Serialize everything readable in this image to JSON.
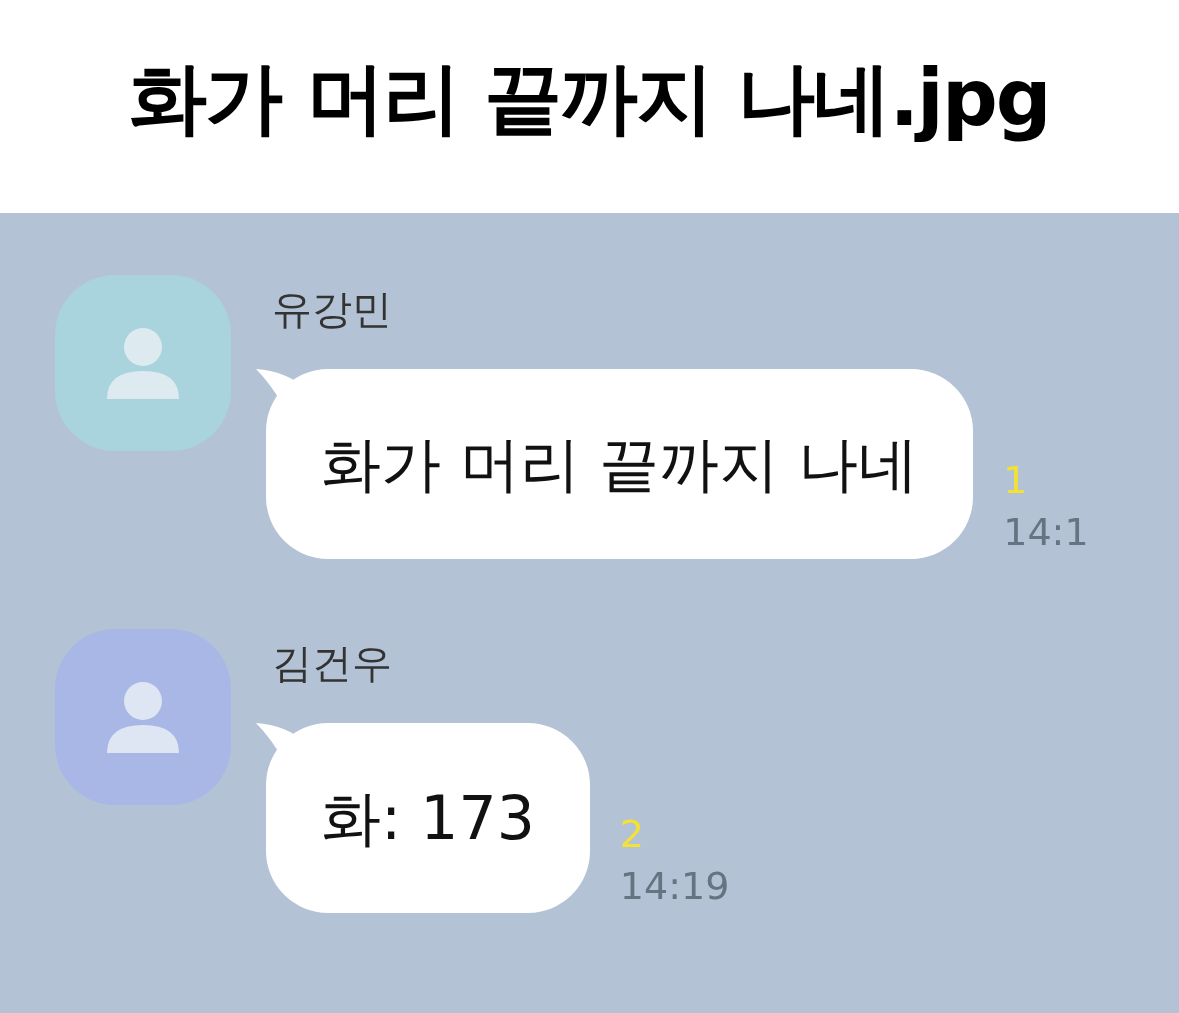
{
  "title": "화가 머리 끝까지 나네.jpg",
  "messages": [
    {
      "sender": "유강민",
      "color": "#a9d3dd",
      "text": "화가 머리 끝까지 나네",
      "unread": "1",
      "time": "14:1"
    },
    {
      "sender": "김건우",
      "color": "#a9b7e6",
      "text": "화: 173",
      "unread": "2",
      "time": "14:19"
    }
  ]
}
